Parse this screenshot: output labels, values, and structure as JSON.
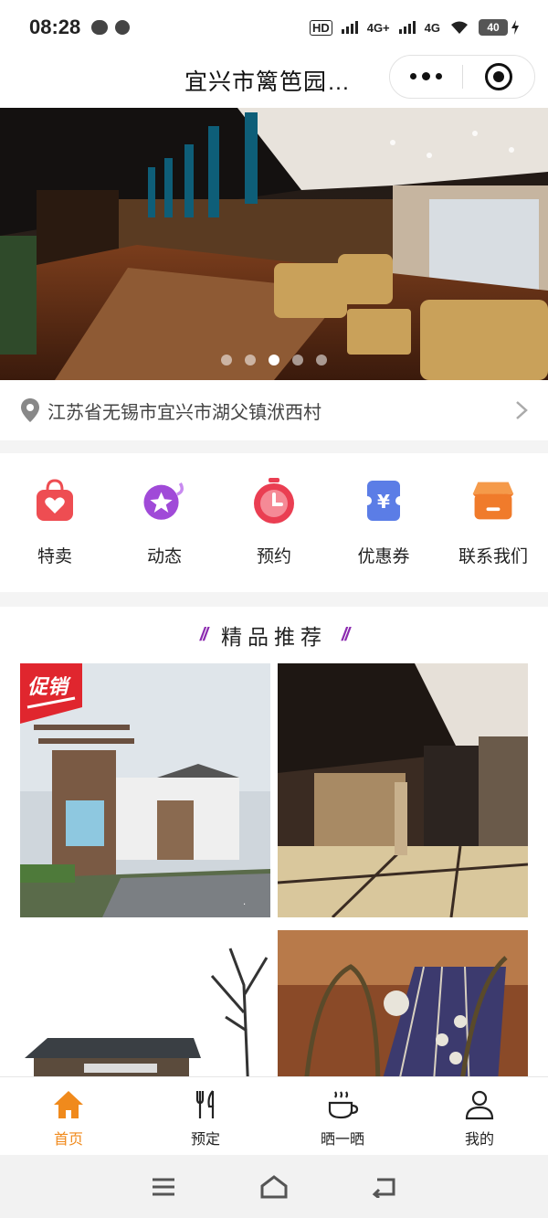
{
  "status_bar": {
    "time": "08:28",
    "battery": "40",
    "network_1": "4G+",
    "network_2": "4G",
    "hd": "HD"
  },
  "header": {
    "title": "宜兴市篱笆园…"
  },
  "banner": {
    "active_index": 2,
    "count": 5
  },
  "address": {
    "text": "江苏省无锡市宜兴市湖父镇洑西村"
  },
  "menu": [
    {
      "label": "特卖",
      "icon": "shopping-bag-heart-icon",
      "color": "#ee4d52"
    },
    {
      "label": "动态",
      "icon": "star-bubble-icon",
      "color": "#a04ad8"
    },
    {
      "label": "预约",
      "icon": "alarm-clock-icon",
      "color": "#ea3e52"
    },
    {
      "label": "优惠券",
      "icon": "yuan-ticket-icon",
      "color": "#5b7de6"
    },
    {
      "label": "联系我们",
      "icon": "shop-store-icon",
      "color": "#f07b2b"
    }
  ],
  "recommend": {
    "title": "精品推荐",
    "promo_badge": "促销",
    "items": [
      {
        "image": "entrance-gate-photo"
      },
      {
        "image": "lobby-photo"
      },
      {
        "image": "building-tree-photo"
      },
      {
        "image": "tea-table-photo"
      }
    ]
  },
  "tabbar": [
    {
      "label": "首页",
      "icon": "home-icon",
      "active": true
    },
    {
      "label": "预定",
      "icon": "fork-knife-icon",
      "active": false
    },
    {
      "label": "晒一晒",
      "icon": "coffee-cup-icon",
      "active": false
    },
    {
      "label": "我的",
      "icon": "user-icon",
      "active": false
    }
  ],
  "colors": {
    "accent": "#f08a1c",
    "title_slash": "#8c2bb0"
  }
}
